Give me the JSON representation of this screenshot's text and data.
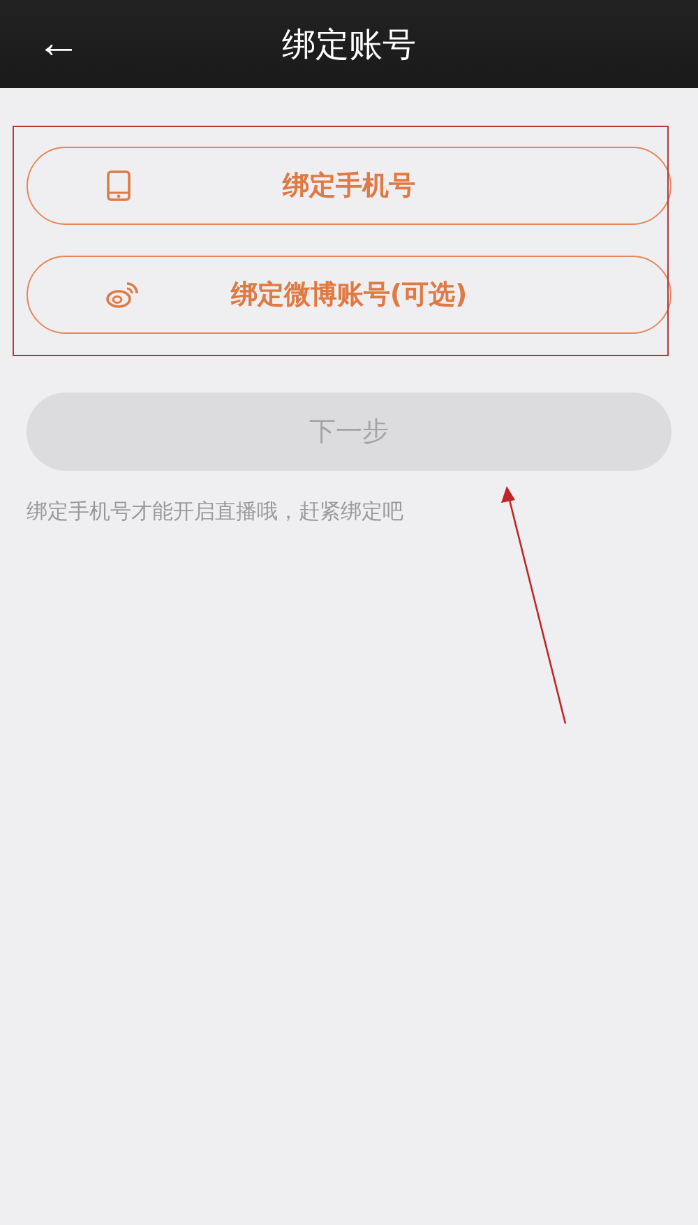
{
  "header": {
    "back_icon": "←",
    "title": "绑定账号"
  },
  "bind_options": [
    {
      "kind": "phone",
      "label": "绑定手机号"
    },
    {
      "kind": "weibo",
      "label": "绑定微博账号(可选)"
    }
  ],
  "next_button": {
    "label": "下一步",
    "disabled": true
  },
  "hint": "绑定手机号才能开启直播哦，赶紧绑定吧"
}
